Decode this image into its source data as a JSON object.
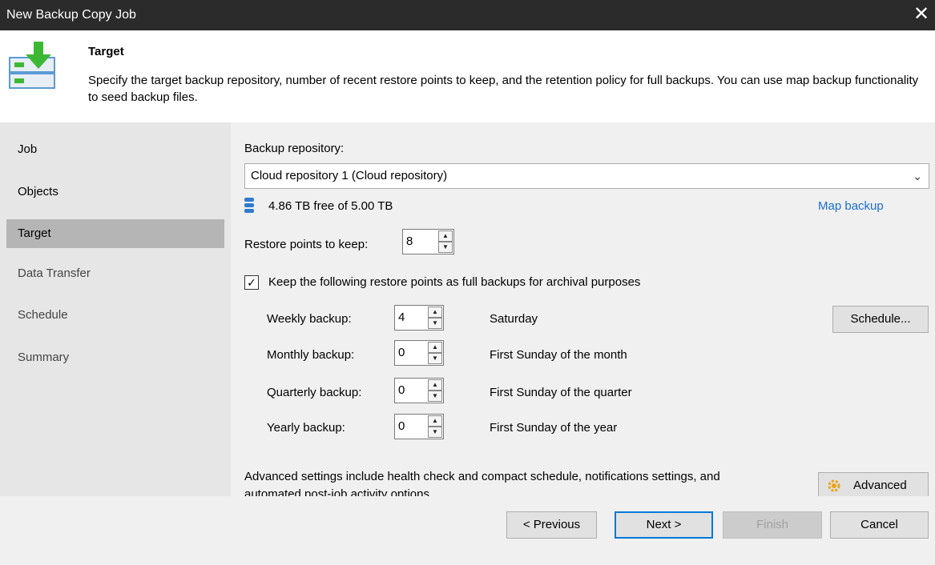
{
  "window": {
    "title": "New Backup Copy Job",
    "close_label": "✕"
  },
  "header": {
    "title": "Target",
    "description": "Specify the target backup repository, number of recent restore points to keep, and the retention policy for full backups. You can use map backup functionality to seed backup files."
  },
  "sidebar": {
    "items": [
      {
        "label": "Job",
        "state": "done"
      },
      {
        "label": "Objects",
        "state": "done"
      },
      {
        "label": "Target",
        "state": "active"
      },
      {
        "label": "Data Transfer",
        "state": "pending"
      },
      {
        "label": "Schedule",
        "state": "pending"
      },
      {
        "label": "Summary",
        "state": "pending"
      }
    ]
  },
  "main": {
    "repo_label": "Backup repository:",
    "repo_value": "Cloud repository 1 (Cloud repository)",
    "free_space": "4.86 TB free of 5.00 TB",
    "map_backup": "Map backup",
    "restore_points_label": "Restore points to keep:",
    "restore_points_value": "8",
    "archival_checkbox_label": "Keep the following restore points as full backups for archival purposes",
    "archival_checked": true,
    "retention": [
      {
        "label": "Weekly backup:",
        "value": "4",
        "when": "Saturday"
      },
      {
        "label": "Monthly backup:",
        "value": "0",
        "when": "First Sunday of the month"
      },
      {
        "label": "Quarterly backup:",
        "value": "0",
        "when": "First Sunday of the quarter"
      },
      {
        "label": "Yearly backup:",
        "value": "0",
        "when": "First Sunday of the year"
      }
    ],
    "schedule_button": "Schedule...",
    "advanced_note": "Advanced settings include health check and compact schedule, notifications settings, and automated post-job activity options.",
    "advanced_button": "Advanced"
  },
  "footer": {
    "previous": "< Previous",
    "next": "Next >",
    "finish": "Finish",
    "cancel": "Cancel"
  },
  "colors": {
    "titlebar": "#2b2b2b",
    "accent_link": "#1a6fd2",
    "sidebar_active": "#b5b5b5",
    "logo_green": "#3db835",
    "logo_blue": "#5b9bd5"
  }
}
